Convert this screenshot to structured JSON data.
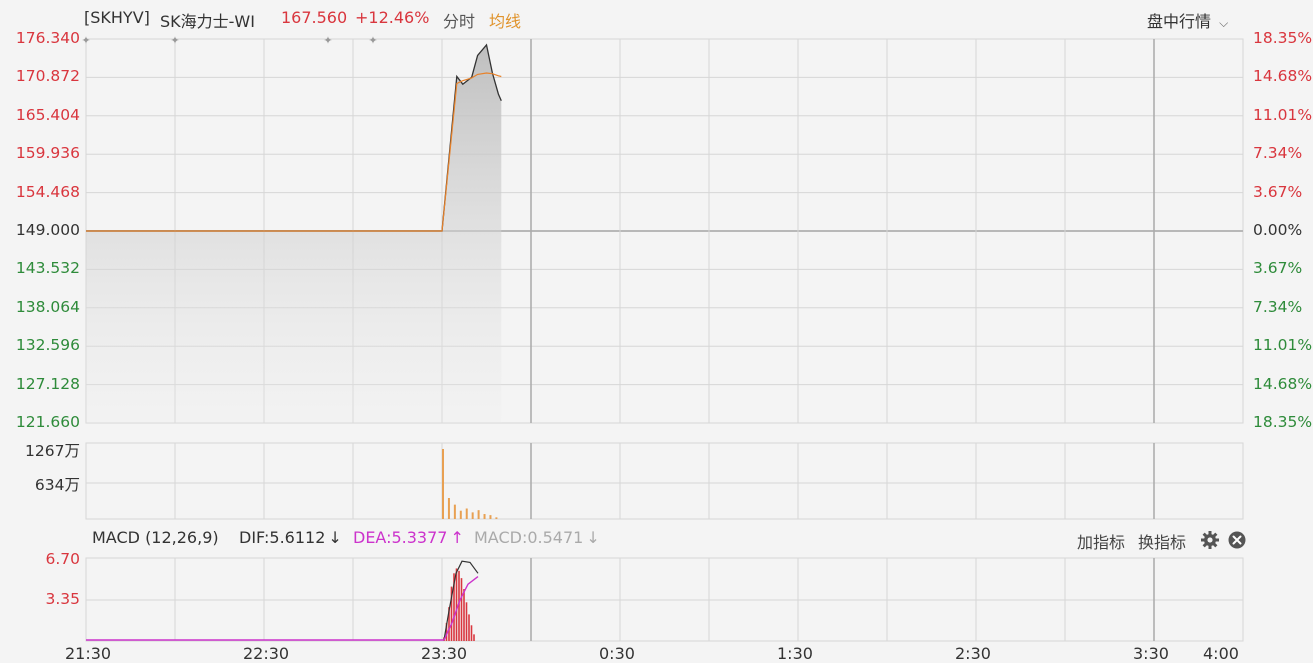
{
  "header": {
    "symbol": "[SKHYV]",
    "name": "SK海力士-WI",
    "price": "167.560",
    "change": "+12.46%",
    "mode_tab": "分时",
    "avg_tab": "均线",
    "session_menu": "盘中行情"
  },
  "price_axis": {
    "left_labels": [
      "176.340",
      "170.872",
      "165.404",
      "159.936",
      "154.468",
      "149.000",
      "143.532",
      "138.064",
      "132.596",
      "127.128",
      "121.660"
    ],
    "right_labels": [
      "18.35%",
      "14.68%",
      "11.01%",
      "7.34%",
      "3.67%",
      "0.00%",
      "3.67%",
      "7.34%",
      "11.01%",
      "14.68%",
      "18.35%"
    ]
  },
  "volume_axis": {
    "labels": [
      "1267万",
      "634万"
    ]
  },
  "macd": {
    "title": "MACD",
    "params": "(12,26,9)",
    "dif_label": "DIF:5.6112",
    "dea_label": "DEA:5.3377",
    "macd_label": "MACD:0.5471",
    "axis_labels": [
      "6.70",
      "3.35"
    ],
    "add_indicator": "加指标",
    "switch_indicator": "换指标"
  },
  "time_axis": {
    "labels": [
      "21:30",
      "22:30",
      "23:30",
      "0:30",
      "1:30",
      "2:30",
      "3:30",
      "4:00"
    ]
  },
  "colors": {
    "up": "#d9363e",
    "down": "#2e8b3a",
    "price_line": "#333333",
    "avg_line": "#e8822a",
    "volume": "#e8a052",
    "dea": "#cc33cc",
    "grid": "#d6d6d6"
  },
  "chart_data": {
    "type": "line",
    "prev_close": 149.0,
    "ylim": [
      121.66,
      176.34
    ],
    "x": [
      "21:30",
      "23:30",
      "23:35",
      "23:37",
      "23:40",
      "23:42",
      "23:45",
      "23:47",
      "23:49",
      "23:50"
    ],
    "series": [
      {
        "values": [
          149.0,
          149.0,
          171.0,
          169.9,
          170.9,
          174.0,
          175.5,
          171.5,
          168.5,
          167.56
        ]
      }
    ],
    "volume": {
      "ylim": [
        0,
        1267
      ],
      "x": [
        "23:30",
        "23:32",
        "23:34",
        "23:36",
        "23:38",
        "23:40",
        "23:42",
        "23:44",
        "23:46",
        "23:48"
      ],
      "values": [
        1267,
        380,
        260,
        150,
        190,
        120,
        160,
        90,
        70,
        30
      ]
    },
    "macd": {
      "ylim": [
        0,
        6.7
      ],
      "bars": [
        0.3,
        1.5,
        2.8,
        4.5,
        5.6,
        6.0,
        5.8,
        5.2,
        4.3,
        3.2,
        2.2,
        1.3,
        0.55
      ],
      "dif_last": 5.6112,
      "dea_last": 5.3377,
      "macd_last": 0.5471
    }
  }
}
